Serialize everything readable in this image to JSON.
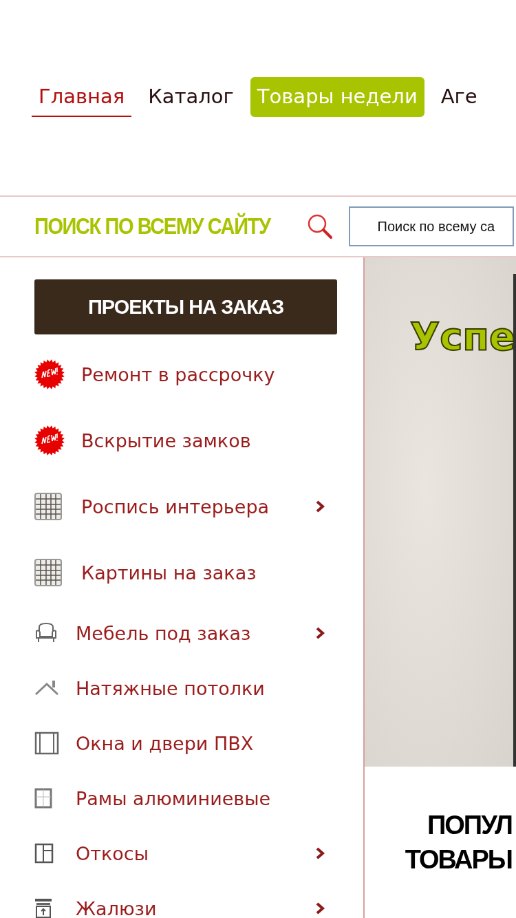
{
  "nav": [
    {
      "label": "Главная",
      "selected": true,
      "highlighted": false
    },
    {
      "label": "Каталог",
      "selected": false,
      "highlighted": false
    },
    {
      "label": "Товары недели",
      "selected": false,
      "highlighted": true
    },
    {
      "label": "Аге",
      "selected": false,
      "highlighted": false
    }
  ],
  "search": {
    "title": "ПОИСК ПО ВСЕМУ САЙТУ",
    "placeholder": "Поиск по всему са"
  },
  "projects_button": "ПРОЕКТЫ НА ЗАКАЗ",
  "menu": [
    {
      "label": "Ремонт в рассрочку",
      "kind": "new",
      "has_submenu": false
    },
    {
      "label": "Вскрытие замков",
      "kind": "new",
      "has_submenu": false
    },
    {
      "label": "Роспись интерьера",
      "kind": "grid",
      "has_submenu": true
    },
    {
      "label": "Картины на заказ",
      "kind": "grid",
      "has_submenu": false
    },
    {
      "label": "Мебель под заказ",
      "kind": "armchair",
      "has_submenu": true
    },
    {
      "label": "Натяжные потолки",
      "kind": "roof",
      "has_submenu": false
    },
    {
      "label": "Окна и двери ПВХ",
      "kind": "window",
      "has_submenu": false
    },
    {
      "label": "Рамы алюминиевые",
      "kind": "frame",
      "has_submenu": false
    },
    {
      "label": "Откосы",
      "kind": "panel",
      "has_submenu": true
    },
    {
      "label": "Жалюзи",
      "kind": "blinds",
      "has_submenu": true
    }
  ],
  "banner": {
    "text": "Успе"
  },
  "popular_heading": [
    "ПОПУЛ",
    "ТОВАРЫ"
  ]
}
